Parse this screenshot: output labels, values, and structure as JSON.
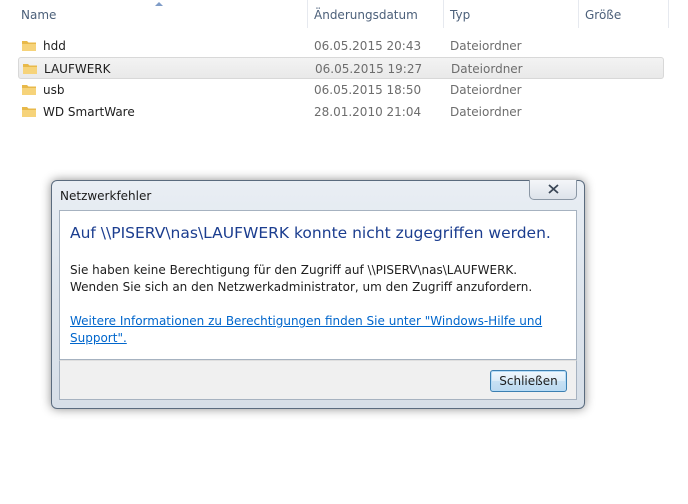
{
  "explorer": {
    "columns": {
      "name": "Name",
      "date": "Änderungsdatum",
      "type": "Typ",
      "size": "Größe"
    },
    "rows": [
      {
        "name": "hdd",
        "date": "06.05.2015 20:43",
        "type": "Dateiordner"
      },
      {
        "name": "LAUFWERK",
        "date": "06.05.2015 19:27",
        "type": "Dateiordner",
        "selected": true
      },
      {
        "name": "usb",
        "date": "06.05.2015 18:50",
        "type": "Dateiordner"
      },
      {
        "name": "WD SmartWare",
        "date": "28.01.2010 21:04",
        "type": "Dateiordner"
      }
    ],
    "icon": "folder-icon"
  },
  "dialog": {
    "title": "Netzwerkfehler",
    "heading": "Auf \\\\PISERV\\nas\\LAUFWERK konnte nicht zugegriffen werden.",
    "body": "Sie haben keine Berechtigung für den Zugriff auf \\\\PISERV\\nas\\LAUFWERK. Wenden Sie sich an den Netzwerkadministrator, um den Zugriff anzufordern.",
    "link": "Weitere Informationen zu Berechtigungen finden Sie unter \"Windows-Hilfe und Support\".",
    "close_label": "Schließen",
    "close_icon": "close-icon"
  },
  "colors": {
    "heading": "#1b3d8f",
    "link": "#0066cc",
    "header_text": "#4c607a"
  }
}
